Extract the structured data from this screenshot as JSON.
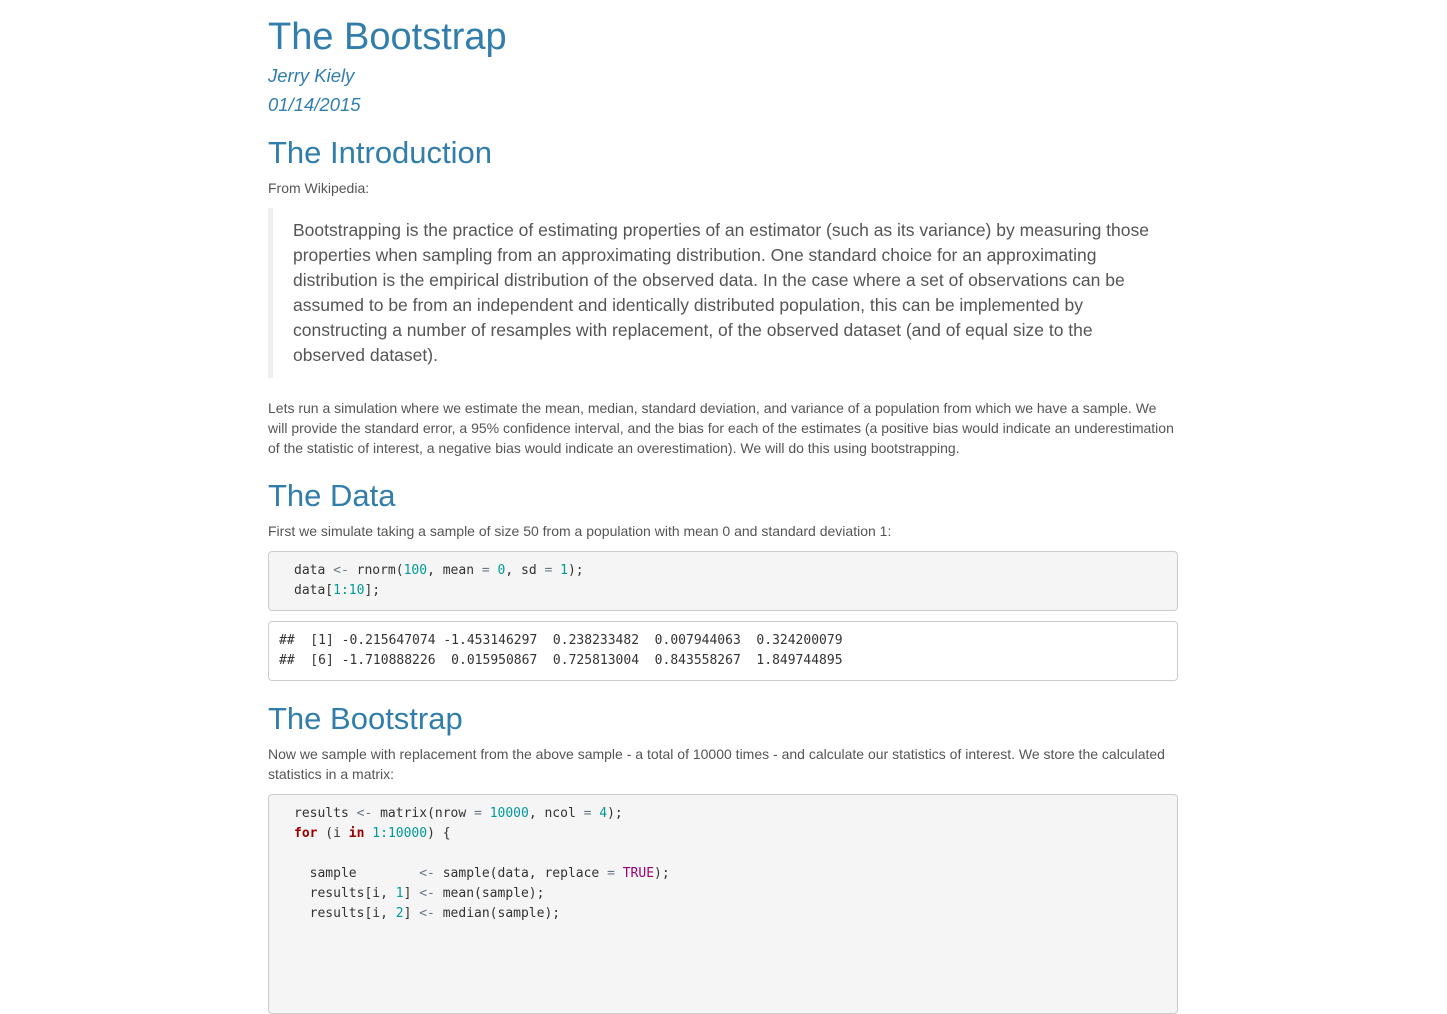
{
  "doc": {
    "title": "The Bootstrap",
    "author": "Jerry Kiely",
    "date": "01/14/2015"
  },
  "intro": {
    "heading": "The Introduction",
    "from": "From Wikipedia:",
    "quote": "Bootstrapping is the practice of estimating properties of an estimator (such as its variance) by measuring those properties when sampling from an approximating distribution. One standard choice for an approximating distribution is the empirical distribution of the observed data. In the case where a set of observations can be assumed to be from an independent and identically distributed population, this can be implemented by constructing a number of resamples with replacement, of the observed dataset (and of equal size to the observed dataset).",
    "paragraph": "Lets run a simulation where we estimate the mean, median, standard deviation, and variance of a population from which we have a sample. We will provide the standard error, a 95% confidence interval, and the bias for each of the estimates (a positive bias would indicate an underestimation of the statistic of interest, a negative bias would indicate an overestimation). We will do this using bootstrapping."
  },
  "data_section": {
    "heading": "The Data",
    "paragraph": "First we simulate taking a sample of size 50 from a population with mean 0 and standard deviation 1:",
    "code": {
      "l1": {
        "a": "data ",
        "b": "<-",
        "c": " rnorm(",
        "d": "100",
        "e": ", mean ",
        "f": "=",
        "g": " ",
        "h": "0",
        "i": ", sd ",
        "j": "=",
        "k": " ",
        "l": "1",
        "m": ");"
      },
      "l2": {
        "a": "data[",
        "b": "1",
        "c": ":",
        "d": "10",
        "e": "];"
      }
    },
    "output": [
      "##  [1] -0.215647074 -1.453146297  0.238233482  0.007944063  0.324200079",
      "##  [6] -1.710888226  0.015950867  0.725813004  0.843558267  1.849744895"
    ]
  },
  "boot_section": {
    "heading": "The Bootstrap",
    "paragraph": "Now we sample with replacement from the above sample - a total of 10000 times - and calculate our statistics of interest. We store the calculated statistics in a matrix:",
    "code": {
      "l1": {
        "a": "results ",
        "b": "<-",
        "c": " matrix(nrow ",
        "d": "=",
        "e": " ",
        "f": "10000",
        "g": ", ncol ",
        "h": "=",
        "i": " ",
        "j": "4",
        "k": ");"
      },
      "l2": {
        "a": "for",
        "b": " (i ",
        "c": "in",
        "d": " ",
        "e": "1",
        "f": ":",
        "g": "10000",
        "h": ") {"
      },
      "l4": {
        "a": "  sample        ",
        "b": "<-",
        "c": " sample(data, replace ",
        "d": "=",
        "e": " ",
        "f": "TRUE",
        "g": ");"
      },
      "l5": {
        "a": "  results[i, ",
        "b": "1",
        "c": "] ",
        "d": "<-",
        "e": " mean(sample);"
      },
      "l6": {
        "a": "  results[i, ",
        "b": "2",
        "c": "] ",
        "d": "<-",
        "e": " median(sample);"
      }
    }
  }
}
